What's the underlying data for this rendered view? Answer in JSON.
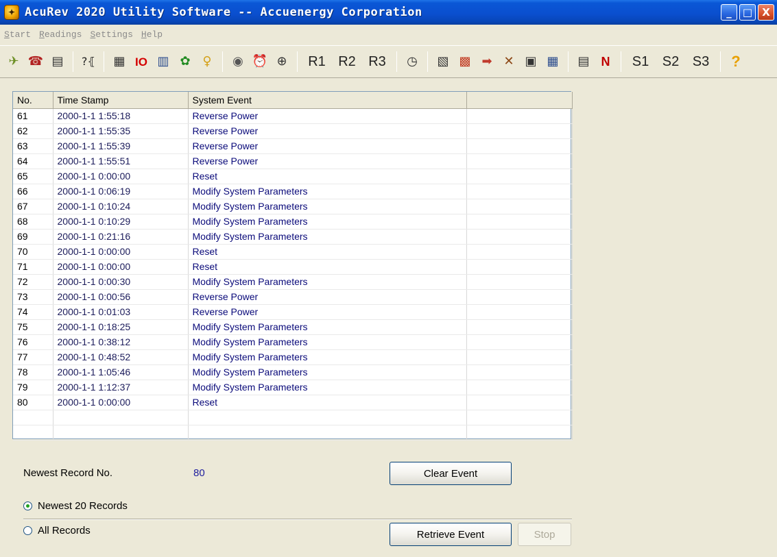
{
  "window": {
    "title": "AcuRev 2020 Utility Software -- Accuenergy Corporation",
    "minimize": "_",
    "maximize": "□",
    "close": "X"
  },
  "menu": [
    "Start",
    "Readings",
    "Settings",
    "Help"
  ],
  "toolbar": {
    "r_buttons": [
      "R1",
      "R2",
      "R3"
    ],
    "s_buttons": [
      "S1",
      "S2",
      "S3"
    ],
    "io_label": "IO",
    "n_label": "N",
    "help_label": "?"
  },
  "table": {
    "columns": [
      "No.",
      "Time Stamp",
      "System Event",
      ""
    ],
    "rows": [
      [
        "61",
        "2000-1-1 1:55:18",
        "Reverse Power"
      ],
      [
        "62",
        "2000-1-1 1:55:35",
        "Reverse Power"
      ],
      [
        "63",
        "2000-1-1 1:55:39",
        "Reverse Power"
      ],
      [
        "64",
        "2000-1-1 1:55:51",
        "Reverse Power"
      ],
      [
        "65",
        "2000-1-1 0:00:00",
        "Reset"
      ],
      [
        "66",
        "2000-1-1 0:06:19",
        "Modify System Parameters"
      ],
      [
        "67",
        "2000-1-1 0:10:24",
        "Modify System Parameters"
      ],
      [
        "68",
        "2000-1-1 0:10:29",
        "Modify System Parameters"
      ],
      [
        "69",
        "2000-1-1 0:21:16",
        "Modify System Parameters"
      ],
      [
        "70",
        "2000-1-1 0:00:00",
        "Reset"
      ],
      [
        "71",
        "2000-1-1 0:00:00",
        "Reset"
      ],
      [
        "72",
        "2000-1-1 0:00:30",
        "Modify System Parameters"
      ],
      [
        "73",
        "2000-1-1 0:00:56",
        "Reverse Power"
      ],
      [
        "74",
        "2000-1-1 0:01:03",
        "Reverse Power"
      ],
      [
        "75",
        "2000-1-1 0:18:25",
        "Modify System Parameters"
      ],
      [
        "76",
        "2000-1-1 0:38:12",
        "Modify System Parameters"
      ],
      [
        "77",
        "2000-1-1 0:48:52",
        "Modify System Parameters"
      ],
      [
        "78",
        "2000-1-1 1:05:46",
        "Modify System Parameters"
      ],
      [
        "79",
        "2000-1-1 1:12:37",
        "Modify System Parameters"
      ],
      [
        "80",
        "2000-1-1 0:00:00",
        "Reset"
      ]
    ]
  },
  "controls": {
    "newest_record_label": "Newest Record No.",
    "newest_record_value": "80",
    "clear_event": "Clear Event",
    "radio_newest": "Newest 20 Records",
    "radio_all": "All Records",
    "retrieve_event": "Retrieve Event",
    "stop": "Stop"
  }
}
